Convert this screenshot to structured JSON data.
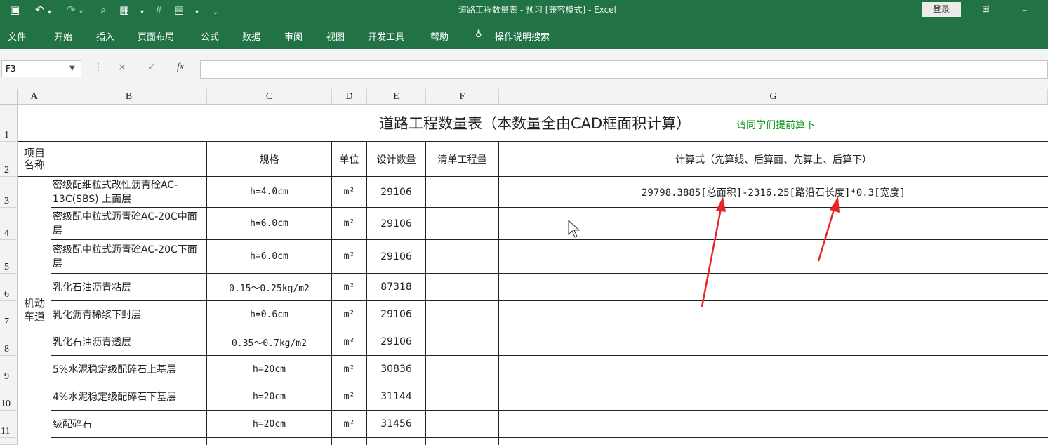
{
  "window": {
    "title": "道路工程数量表 - 预习 [兼容模式] - Excel",
    "login_label": "登录"
  },
  "ribbon": {
    "tabs": [
      "文件",
      "开始",
      "插入",
      "页面布局",
      "公式",
      "数据",
      "审阅",
      "视图",
      "开发工具",
      "帮助"
    ],
    "tell_me": "操作说明搜索"
  },
  "formula_bar": {
    "name_box": "F3",
    "cancel_icon": "×",
    "enter_icon": "✓",
    "fx_icon": "fx",
    "value": ""
  },
  "columns": [
    "A",
    "B",
    "C",
    "D",
    "E",
    "F",
    "G"
  ],
  "rows": [
    "1",
    "2",
    "3",
    "4",
    "5",
    "6",
    "7",
    "8",
    "9",
    "10",
    "11"
  ],
  "sheet": {
    "title": "道路工程数量表（本数量全由CAD框面积计算）",
    "title_note": "请同学们提前算下",
    "headers": {
      "a": "项目名称",
      "c": "规格",
      "d": "单位",
      "e": "设计数量",
      "f": "清单工程量",
      "g": "计算式（先算线、后算面、先算上、后算下）"
    },
    "group_label": "机动车道",
    "unit": "m²",
    "items": [
      {
        "name": "密级配细粒式改性沥青砼AC-13C(SBS) 上面层",
        "spec": "h=4.0cm",
        "qty": "29106",
        "formula": "29798.3885[总面积]-2316.25[路沿石长度]*0.3[宽度]"
      },
      {
        "name": "密级配中粒式沥青砼AC-20C中面层",
        "spec": "h=6.0cm",
        "qty": "29106",
        "formula": ""
      },
      {
        "name": "密级配中粒式沥青砼AC-20C下面层",
        "spec": "h=6.0cm",
        "qty": "29106",
        "formula": ""
      },
      {
        "name": "乳化石油沥青粘层",
        "spec": "0.15～0.25kg/m2",
        "qty": "87318",
        "formula": ""
      },
      {
        "name": "乳化沥青稀浆下封层",
        "spec": "h=0.6cm",
        "qty": "29106",
        "formula": ""
      },
      {
        "name": "乳化石油沥青透层",
        "spec": "0.35～0.7kg/m2",
        "qty": "29106",
        "formula": ""
      },
      {
        "name": "5%水泥稳定级配碎石上基层",
        "spec": "h=20cm",
        "qty": "30836",
        "formula": ""
      },
      {
        "name": "4%水泥稳定级配碎石下基层",
        "spec": "h=20cm",
        "qty": "31144",
        "formula": ""
      },
      {
        "name": "级配碎石",
        "spec": "h=20cm",
        "qty": "31456",
        "formula": ""
      }
    ]
  },
  "colors": {
    "ribbon": "#217346",
    "annotation_arrow": "#e8262a",
    "note_text": "#119a1d"
  }
}
